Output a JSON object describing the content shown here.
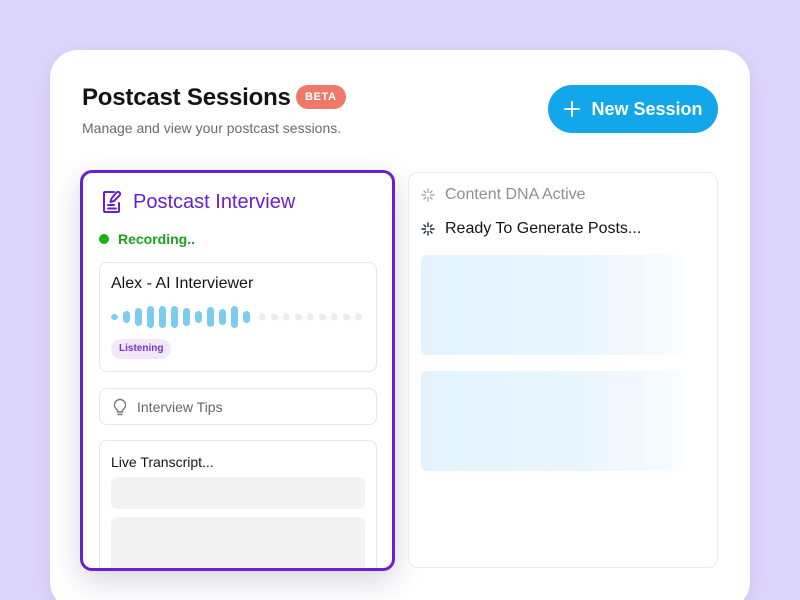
{
  "header": {
    "title": "Postcast Sessions",
    "badge": "BETA",
    "subtitle": "Manage and view your postcast sessions.",
    "new_session_label": "New Session"
  },
  "interview_panel": {
    "title": "Postcast Interview",
    "status": "Recording..",
    "interviewer": {
      "name": "Alex - AI Interviewer",
      "status_badge": "Listening"
    },
    "tips_label": "Interview Tips",
    "transcript_label": "Live Transcript..."
  },
  "content_panel": {
    "dna_label": "Content DNA Active",
    "ready_label": "Ready To Generate Posts..."
  },
  "colors": {
    "background": "#ddd6fc",
    "accent_purple": "#6a20cf",
    "primary_blue": "#12a7eb",
    "beta_badge": "#f0786a",
    "recording_green": "#19b319",
    "wave_active": "#7dcbef",
    "wave_idle": "#ececec"
  },
  "icons": {
    "plus": "plus-icon",
    "interview": "document-edit-icon",
    "tips": "lightbulb-icon",
    "dna": "sparkle-icon"
  }
}
